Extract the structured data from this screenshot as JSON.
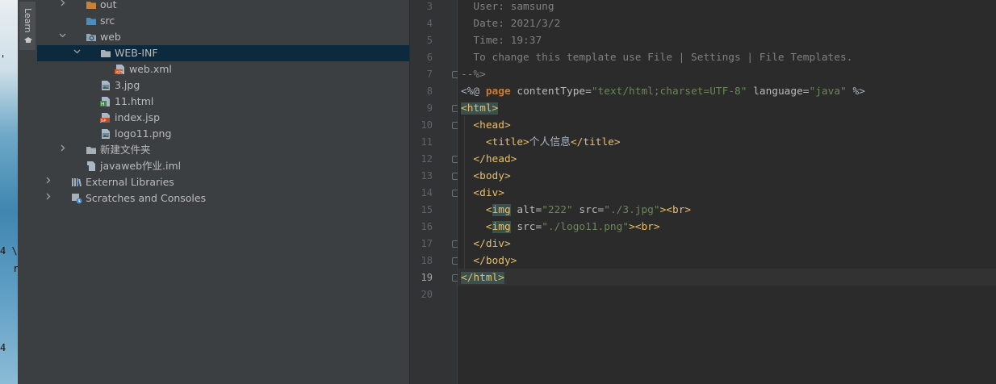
{
  "desktop": {
    "glyphs": [
      "4 \\",
      "r",
      "4",
      "'"
    ]
  },
  "tool_strip": {
    "learn_label": "Learn"
  },
  "project_tree": [
    {
      "label": "out",
      "type": "folder-orange",
      "arrow": ">"
    },
    {
      "label": "src",
      "type": "folder-blue",
      "arrow": ""
    },
    {
      "label": "web",
      "type": "folder-web",
      "arrow": "v"
    },
    {
      "label": "WEB-INF",
      "type": "folder",
      "arrow": "v",
      "selected": true
    },
    {
      "label": "web.xml",
      "type": "xml-file",
      "arrow": ""
    },
    {
      "label": "3.jpg",
      "type": "image-file",
      "arrow": ""
    },
    {
      "label": "11.html",
      "type": "html-file",
      "arrow": ""
    },
    {
      "label": "index.jsp",
      "type": "jsp-file",
      "arrow": ""
    },
    {
      "label": "logo11.png",
      "type": "image-file",
      "arrow": ""
    },
    {
      "label": "新建文件夹",
      "type": "folder",
      "arrow": ">"
    },
    {
      "label": "javaweb作业.iml",
      "type": "iml-file",
      "arrow": ""
    },
    {
      "label": "External Libraries",
      "type": "libraries",
      "arrow": ">"
    },
    {
      "label": "Scratches and Consoles",
      "type": "scratches",
      "arrow": ">"
    }
  ],
  "editor": {
    "current_line": 19,
    "lines": [
      {
        "n": "3",
        "t": "  User: samsung"
      },
      {
        "n": "4",
        "t": "  Date: 2021/3/2"
      },
      {
        "n": "5",
        "t": "  Time: 19:37"
      },
      {
        "n": "6",
        "t": "  To change this template use File | Settings | File Templates."
      },
      {
        "n": "7",
        "t": "--%>"
      },
      {
        "n": "8",
        "p": [
          "<%@ ",
          "page",
          " contentType=",
          "\"text/html;charset=UTF-8\"",
          " language=",
          "\"java\"",
          " %>"
        ]
      },
      {
        "n": "9",
        "t": "<html>"
      },
      {
        "n": "10",
        "t": "  <head>"
      },
      {
        "n": "11",
        "t": "    <title>个人信息</title>"
      },
      {
        "n": "12",
        "t": "  </head>"
      },
      {
        "n": "13",
        "t": "  <body>"
      },
      {
        "n": "14",
        "t": "  <div>"
      },
      {
        "n": "15",
        "p": [
          "    <",
          "img",
          " alt=",
          "\"222\"",
          " src=",
          "\"./3.jpg\"",
          "><br>"
        ]
      },
      {
        "n": "16",
        "p": [
          "    <",
          "img",
          " src=",
          "\"./logo11.png\"",
          "><br>"
        ]
      },
      {
        "n": "17",
        "t": "  </div>"
      },
      {
        "n": "18",
        "t": "  </body>"
      },
      {
        "n": "19",
        "t": "</html>"
      },
      {
        "n": "20",
        "t": ""
      }
    ]
  },
  "colors": {
    "panel_bg": "#3c3f41",
    "editor_bg": "#2b2b2b",
    "selection": "#0d293e",
    "tag": "#e8bf6a",
    "string": "#6a8759",
    "comment": "#808080",
    "keyword": "#cc7832"
  }
}
